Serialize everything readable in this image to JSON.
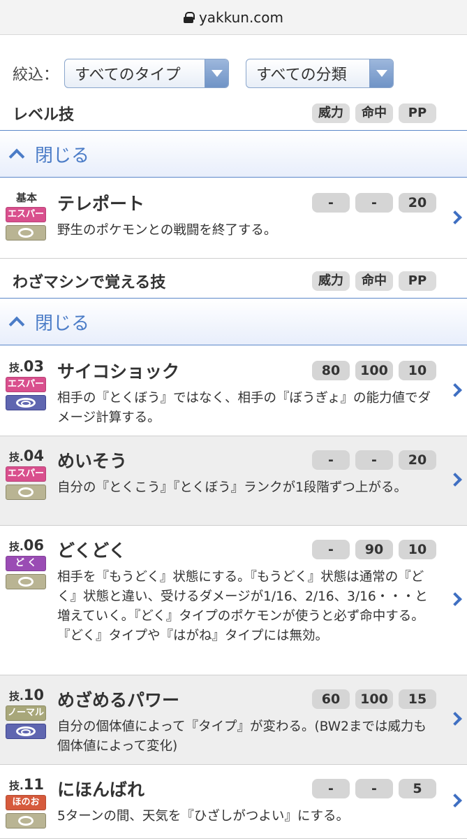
{
  "browser": {
    "url": "yakkun.com"
  },
  "filter": {
    "label": "絞込：",
    "type_select": "すべてのタイプ",
    "category_select": "すべての分類"
  },
  "columns": {
    "power": "威力",
    "accuracy": "命中",
    "pp": "PP"
  },
  "level_section": {
    "title": "レベル技",
    "close_label": "閉じる"
  },
  "tm_section": {
    "title": "わざマシンで覚える技",
    "close_label": "閉じる"
  },
  "colors": {
    "psychic": "#d94f8d",
    "poison": "#9a4cb4",
    "normal": "#a8a77a",
    "fire": "#d65a3c",
    "accent": "#4b7cc7"
  },
  "level_moves": [
    {
      "prefix": "基本",
      "num": "",
      "type": "エスパー",
      "type_color": "#d94f8d",
      "category": "status",
      "category_icon": "status-icon",
      "name": "テレポート",
      "power": "-",
      "accuracy": "-",
      "pp": "20",
      "desc": "野生のポケモンとの戦闘を終了する。"
    }
  ],
  "tm_moves": [
    {
      "prefix": "技.",
      "num": "03",
      "type": "エスパー",
      "type_color": "#d94f8d",
      "category": "special",
      "category_icon": "special-icon",
      "name": "サイコショック",
      "power": "80",
      "accuracy": "100",
      "pp": "10",
      "desc": "相手の『とくぼう』ではなく、相手の『ぼうぎょ』の能力値でダメージ計算する。"
    },
    {
      "prefix": "技.",
      "num": "04",
      "type": "エスパー",
      "type_color": "#d94f8d",
      "category": "status",
      "category_icon": "status-icon",
      "name": "めいそう",
      "power": "-",
      "accuracy": "-",
      "pp": "20",
      "desc": "自分の『とくこう』『とくぼう』ランクが1段階ずつ上がる。"
    },
    {
      "prefix": "技.",
      "num": "06",
      "type": "ど く",
      "type_color": "#9a4cb4",
      "category": "status",
      "category_icon": "status-icon",
      "name": "どくどく",
      "power": "-",
      "accuracy": "90",
      "pp": "10",
      "desc": "相手を『もうどく』状態にする。『もうどく』状態は通常の『どく』状態と違い、受けるダメージが1/16、2/16、3/16・・・と増えていく。『どく』タイプのポケモンが使うと必ず命中する。『どく』タイプや『はがね』タイプには無効。"
    },
    {
      "prefix": "技.",
      "num": "10",
      "type": "ノーマル",
      "type_color": "#a8a77a",
      "category": "special",
      "category_icon": "special-icon",
      "name": "めざめるパワー",
      "power": "60",
      "accuracy": "100",
      "pp": "15",
      "desc": "自分の個体値によって『タイプ』が変わる。(BW2までは威力も個体値によって変化)"
    },
    {
      "prefix": "技.",
      "num": "11",
      "type": "ほのお",
      "type_color": "#d65a3c",
      "category": "status",
      "category_icon": "status-icon",
      "name": "にほんばれ",
      "power": "-",
      "accuracy": "-",
      "pp": "5",
      "desc": "5ターンの間、天気を『ひざしがつよい』にする。"
    }
  ]
}
